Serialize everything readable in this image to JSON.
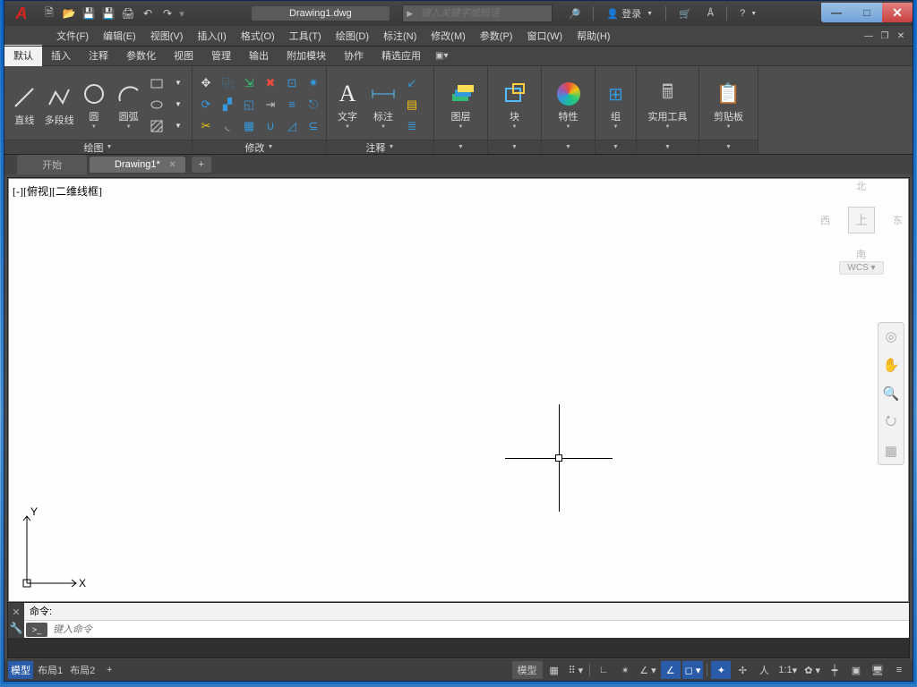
{
  "titlebar": {
    "app_logo": "A",
    "document_title": "Drawing1.dwg",
    "search_placeholder": "键入关键字或短语",
    "login_label": "登录",
    "qat_icons": [
      "new",
      "open",
      "save",
      "saveas",
      "print",
      "undo",
      "redo"
    ]
  },
  "window_controls": {
    "min": "—",
    "max": "□",
    "close": "✕"
  },
  "menubar": [
    "文件(F)",
    "编辑(E)",
    "视图(V)",
    "插入(I)",
    "格式(O)",
    "工具(T)",
    "绘图(D)",
    "标注(N)",
    "修改(M)",
    "参数(P)",
    "窗口(W)",
    "帮助(H)"
  ],
  "ribbon_tabs": [
    "默认",
    "插入",
    "注释",
    "参数化",
    "视图",
    "管理",
    "输出",
    "附加模块",
    "协作",
    "精选应用"
  ],
  "ribbon_active_tab": "默认",
  "panels": {
    "draw": {
      "title": "绘图",
      "big": [
        "直线",
        "多段线",
        "圆",
        "圆弧"
      ]
    },
    "modify": {
      "title": "修改"
    },
    "annot": {
      "title": "注释",
      "big": [
        "文字",
        "标注"
      ]
    },
    "layers": {
      "title": "图层"
    },
    "block": {
      "title": "块"
    },
    "props": {
      "title": "特性"
    },
    "groups": {
      "title": "组"
    },
    "utils": {
      "title": "实用工具"
    },
    "clip": {
      "title": "剪贴板"
    }
  },
  "doc_tabs": {
    "start": "开始",
    "drawing": "Drawing1*",
    "plus": "+"
  },
  "viewport_label": "[-][俯视][二维线框]",
  "viewcube": {
    "n": "北",
    "s": "南",
    "w": "西",
    "e": "东",
    "face": "上",
    "wcs": "WCS"
  },
  "ucs": {
    "x": "X",
    "y": "Y"
  },
  "layout_tabs": {
    "model": "模型",
    "l1": "布局1",
    "l2": "布局2",
    "plus": "+"
  },
  "cmd": {
    "history": "命令:",
    "prompt": ">_",
    "placeholder": "键入命令"
  },
  "statusbar": {
    "model": "模型",
    "scale": "1:1"
  }
}
